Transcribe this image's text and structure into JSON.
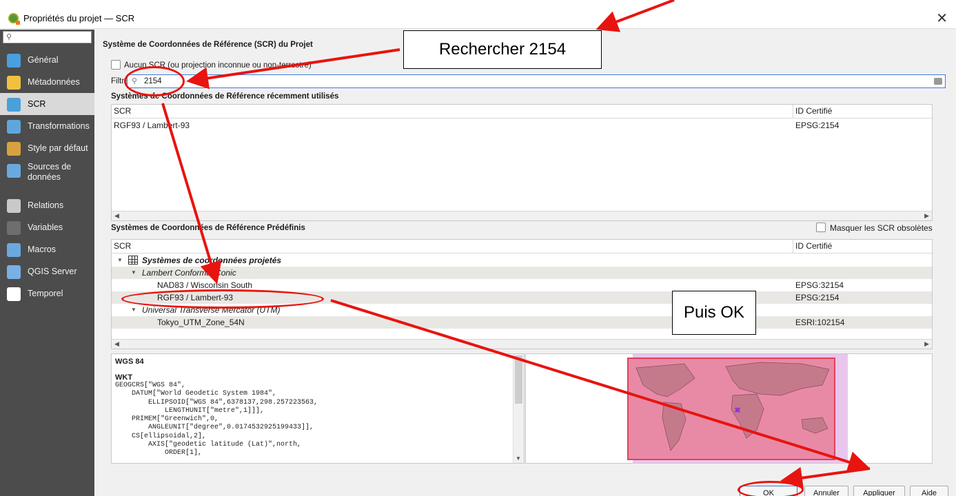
{
  "window": {
    "title": "Propriétés du projet — SCR",
    "close_glyph": "✕"
  },
  "sidebar": {
    "search_placeholder": "",
    "search_icon_glyph": "⚲",
    "items": [
      {
        "label": "Général",
        "icon": "wrench-icon",
        "color": "#4a9fe0"
      },
      {
        "label": "Métadonnées",
        "icon": "pencil-note-icon",
        "color": "#f0c040"
      },
      {
        "label": "SCR",
        "icon": "globe-icon",
        "color": "#4aa0d8",
        "selected": true
      },
      {
        "label": "Transformations",
        "icon": "globe-transform-icon",
        "color": "#5fa6dd"
      },
      {
        "label": "Style par défaut",
        "icon": "brush-icon",
        "color": "#d8a040"
      },
      {
        "label": "Sources de données",
        "icon": "table-icon",
        "color": "#6aa9e0"
      },
      {
        "label": "Relations",
        "icon": "relations-icon",
        "color": "#c9c9c9"
      },
      {
        "label": "Variables",
        "icon": "variables-icon",
        "color": "#6e6e6e"
      },
      {
        "label": "Macros",
        "icon": "macro-gear-icon",
        "color": "#6aa9e0"
      },
      {
        "label": "QGIS Server",
        "icon": "server-icon",
        "color": "#78b0e6"
      },
      {
        "label": "Temporel",
        "icon": "clock-icon",
        "color": "#ffffff"
      }
    ]
  },
  "crs": {
    "section_title": "Système de Coordonnées de Référence (SCR) du Projet",
    "no_crs_label": "Aucun SCR (ou projection inconnue ou non-terrestre)",
    "filter_label": "Filtre",
    "filter_value": "2154",
    "recent_title": "Systèmes de Coordonnées de Référence récemment utilisés",
    "col_crs": "SCR",
    "col_id": "ID Certifié",
    "recent_rows": [
      {
        "name": "RGF93 / Lambert-93",
        "id": "EPSG:2154"
      }
    ],
    "predefined_title": "Systèmes de Coordonnées de Référence Prédéfinis",
    "hide_obsolete_label": "Masquer les SCR obsolètes",
    "tree": {
      "group": "Systèmes de coordonnées projetés",
      "subgroups": [
        {
          "name": "Lambert Conformal Conic",
          "rows": [
            {
              "name": "NAD83 / Wisconsin South",
              "id": "EPSG:32154"
            },
            {
              "name": "RGF93 / Lambert-93",
              "id": "EPSG:2154"
            }
          ]
        },
        {
          "name": "Universal Transverse Mercator (UTM)",
          "rows": [
            {
              "name": "Tokyo_UTM_Zone_54N",
              "id": "ESRI:102154"
            }
          ]
        }
      ]
    },
    "selected_name": "WGS 84",
    "wkt_label": "WKT",
    "wkt_text": "GEOGCRS[\"WGS 84\",\n    DATUM[\"World Geodetic System 1984\",\n        ELLIPSOID[\"WGS 84\",6378137,298.257223563,\n            LENGTHUNIT[\"metre\",1]]],\n    PRIMEM[\"Greenwich\",0,\n        ANGLEUNIT[\"degree\",0.0174532925199433]],\n    CS[ellipsoidal,2],\n        AXIS[\"geodetic latitude (Lat)\",north,\n            ORDER[1],"
  },
  "buttons": {
    "ok": "OK",
    "cancel": "Annuler",
    "apply": "Appliquer",
    "help": "Aide"
  },
  "annotations": {
    "callout_search": "Rechercher 2154",
    "callout_ok": "Puis OK",
    "accent_red": "#e8140f"
  }
}
